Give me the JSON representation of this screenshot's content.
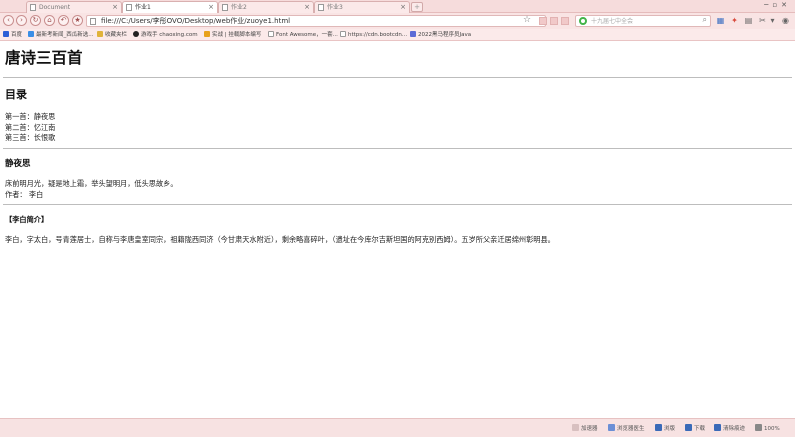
{
  "browser": {
    "tabs": [
      {
        "label": "Document",
        "active": false
      },
      {
        "label": "作业1",
        "active": true
      },
      {
        "label": "作业2",
        "active": false
      },
      {
        "label": "作业3",
        "active": false
      }
    ],
    "url": "file:///C:/Users/李彤OVO/Desktop/web作业/zuoye1.html",
    "search_placeholder": "十九届七中全会",
    "bookmarks": [
      "百度",
      "最新考新闻_西瓜新选...",
      "收藏夹栏",
      "游戏手 chaoxing.com",
      "实战 | 挂载脚本编写",
      "Font Awesome，一套...",
      "https://cdn.bootcdn...",
      "2022黑马程序员Java"
    ],
    "status_items": [
      "加速器",
      "浏览器医生",
      "浏版",
      "下载",
      "清除痕迹",
      "100%"
    ]
  },
  "page": {
    "title": "唐诗三百首",
    "toc_heading": "目录",
    "toc_items": [
      "第一首：静夜思",
      "第二首：忆江南",
      "第三首：长恨歌"
    ],
    "poem_title": "静夜思",
    "poem_text": "床前明月光，疑是地上霜，举头望明月，低头思故乡。",
    "author_line": "作者：  李白",
    "bio_heading": "【李白简介】",
    "bio_text": "李白，字太白，号青莲居士，自称与李唐皇室同宗，祖籍陇西同济（今甘肃天水附近），剩余略喜碎叶，（遗址在今库尔吉斯坦国的阿克别西姆）。五岁所父亲迁居绵州彰明县。"
  },
  "colors": {
    "chrome_pink": "#f6dcdc",
    "separator": "#bdbdbd"
  }
}
